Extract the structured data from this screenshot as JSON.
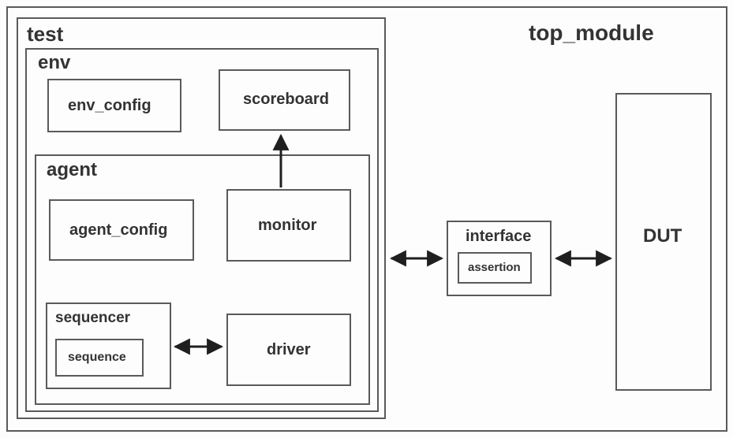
{
  "diagram": {
    "top_module": "top_module",
    "test": "test",
    "env": "env",
    "env_config": "env_config",
    "scoreboard": "scoreboard",
    "agent": "agent",
    "agent_config": "agent_config",
    "monitor": "monitor",
    "sequencer": "sequencer",
    "sequence": "sequence",
    "driver": "driver",
    "interface": "interface",
    "assertion": "assertion",
    "dut": "DUT"
  },
  "connections": [
    {
      "from": "monitor",
      "to": "scoreboard",
      "direction": "unidirectional"
    },
    {
      "from": "sequencer",
      "to": "driver",
      "direction": "bidirectional"
    },
    {
      "from": "agent",
      "to": "interface",
      "direction": "bidirectional"
    },
    {
      "from": "interface",
      "to": "DUT",
      "direction": "bidirectional"
    }
  ]
}
